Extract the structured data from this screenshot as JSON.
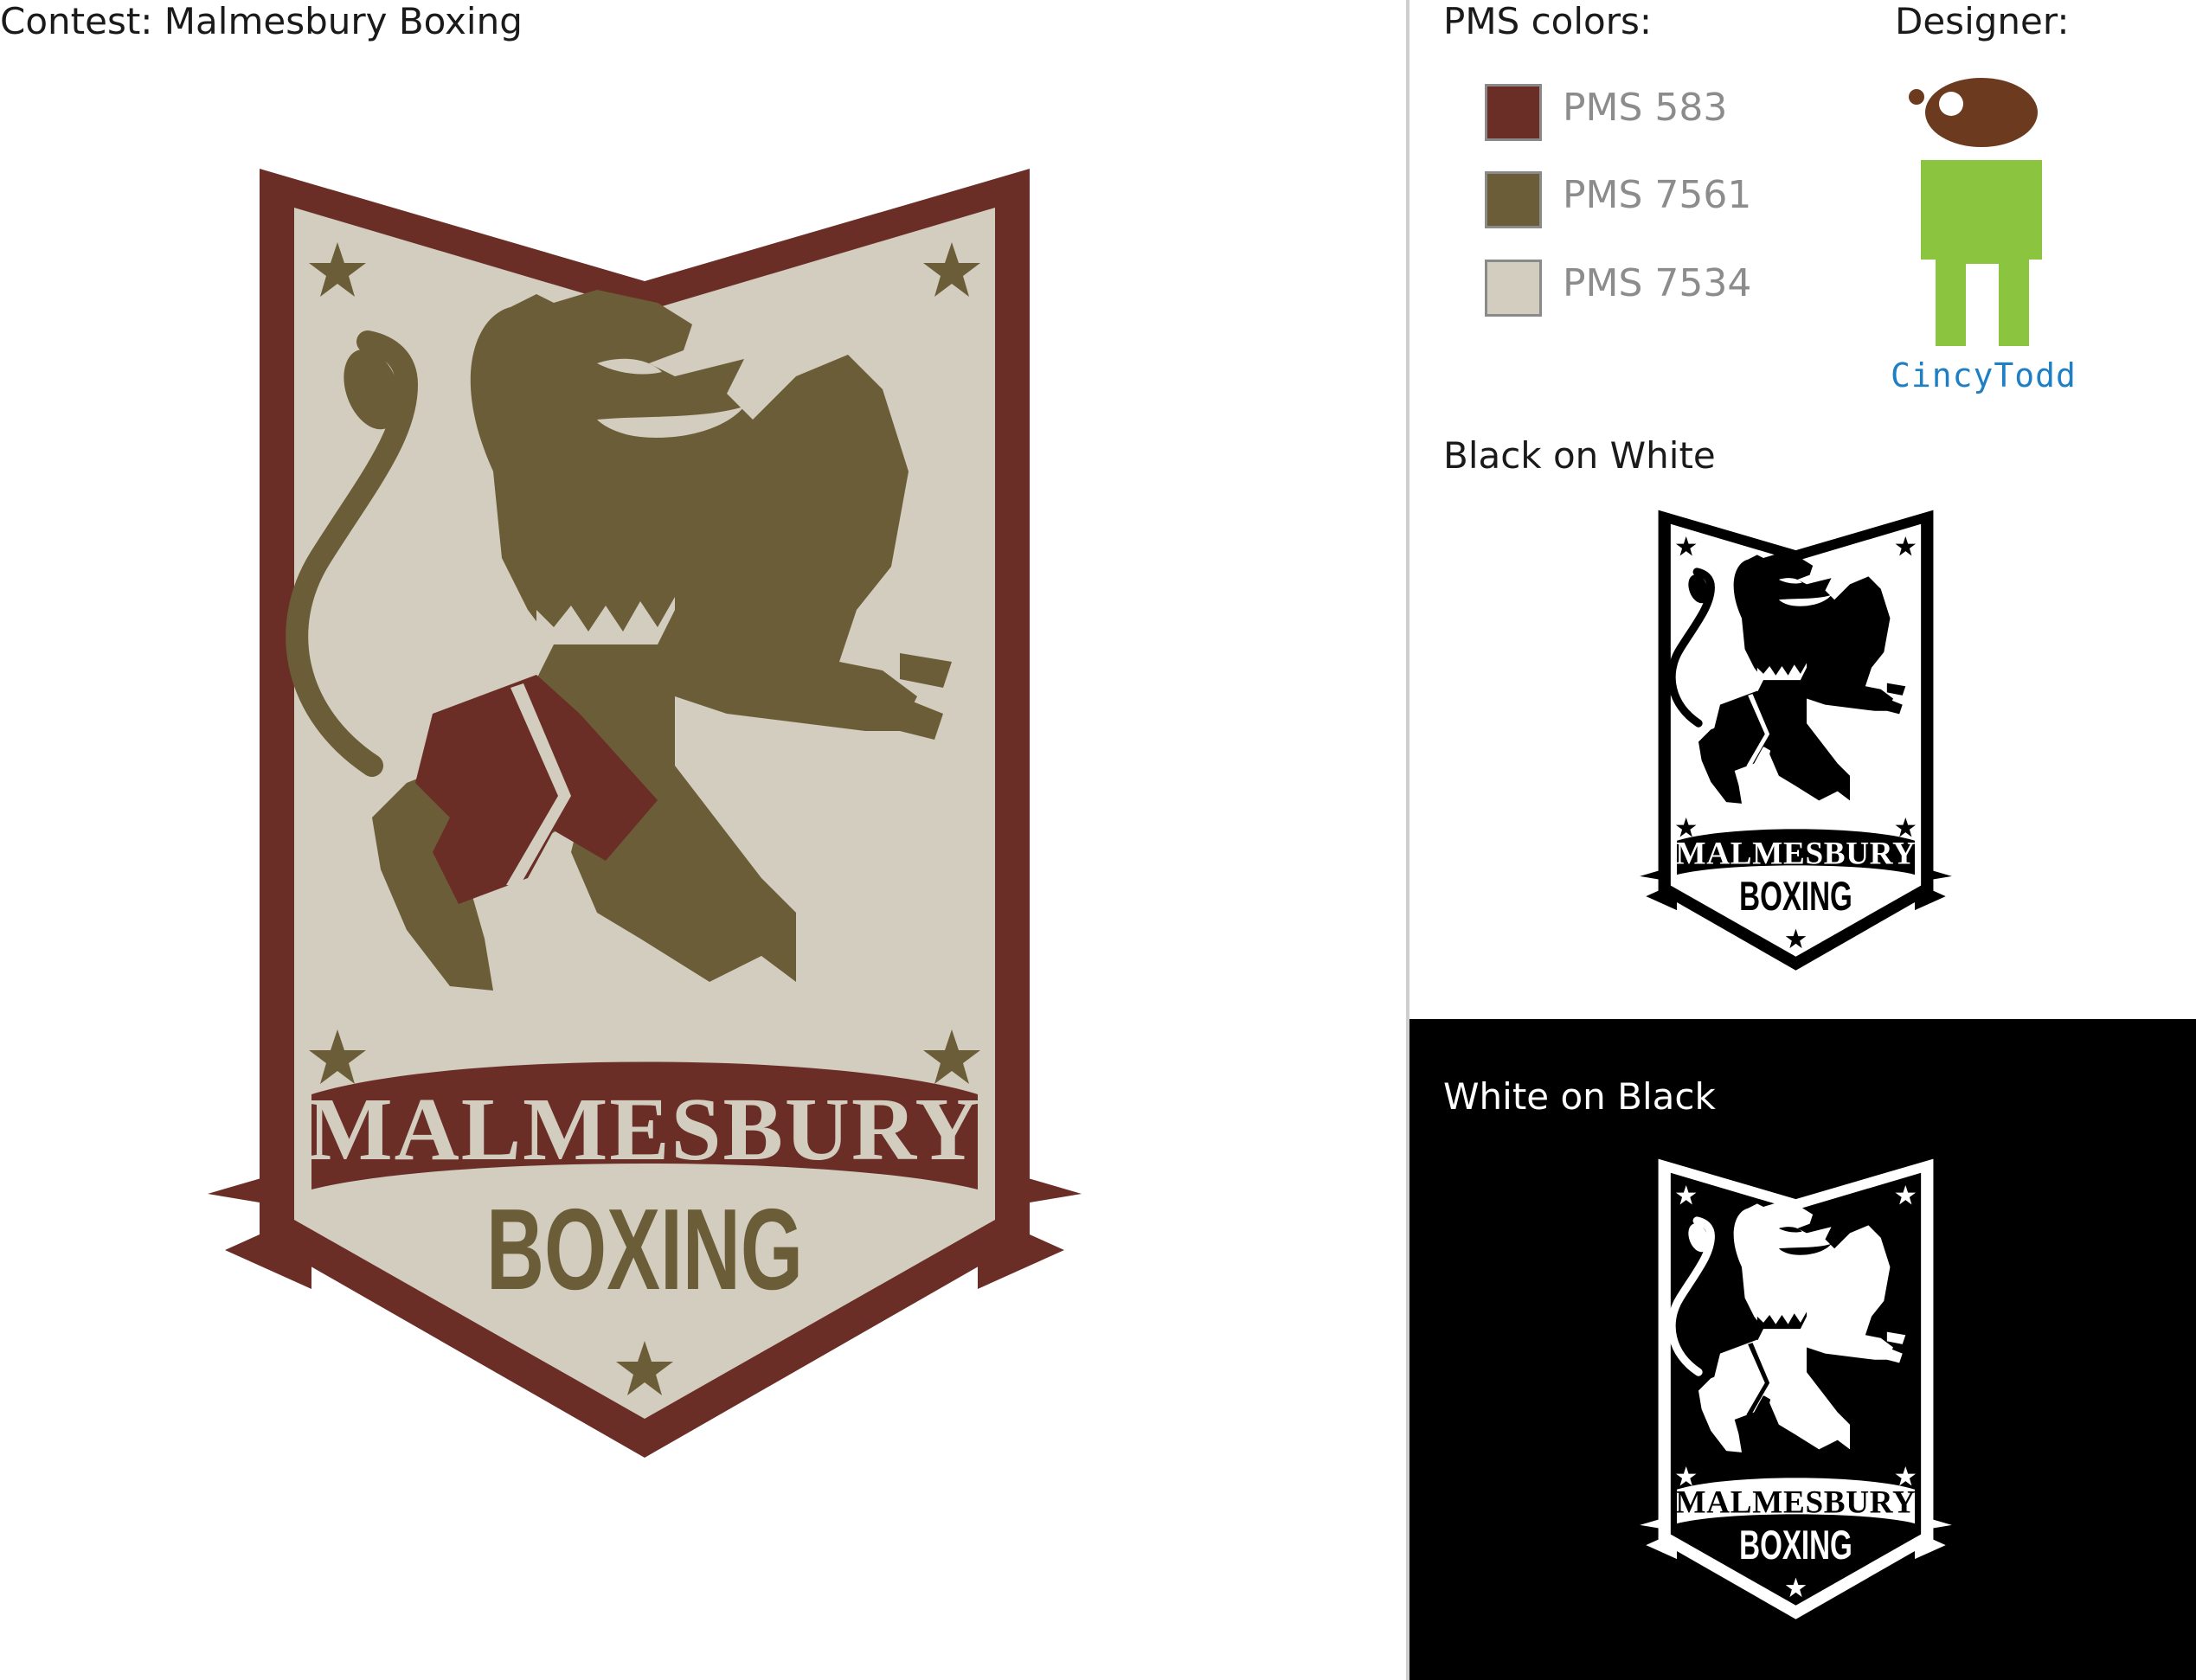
{
  "contest_title": "Contest: Malmesbury Boxing",
  "badge": {
    "line1": "MALMESBURY",
    "line2": "BOXING"
  },
  "pms_heading": "PMS colors:",
  "swatches": [
    {
      "name": "PMS 583",
      "color": "#6b2e26"
    },
    {
      "name": "PMS 7561",
      "color": "#6b5d37"
    },
    {
      "name": "PMS 7534",
      "color": "#d2cdbf"
    }
  ],
  "designer": {
    "heading": "Designer:",
    "name": "CincyTodd",
    "head_color": "#6b3a1f",
    "body_color": "#8bc53f"
  },
  "variants": {
    "black_on_white_label": "Black on White",
    "white_on_black_label": "White on Black"
  }
}
